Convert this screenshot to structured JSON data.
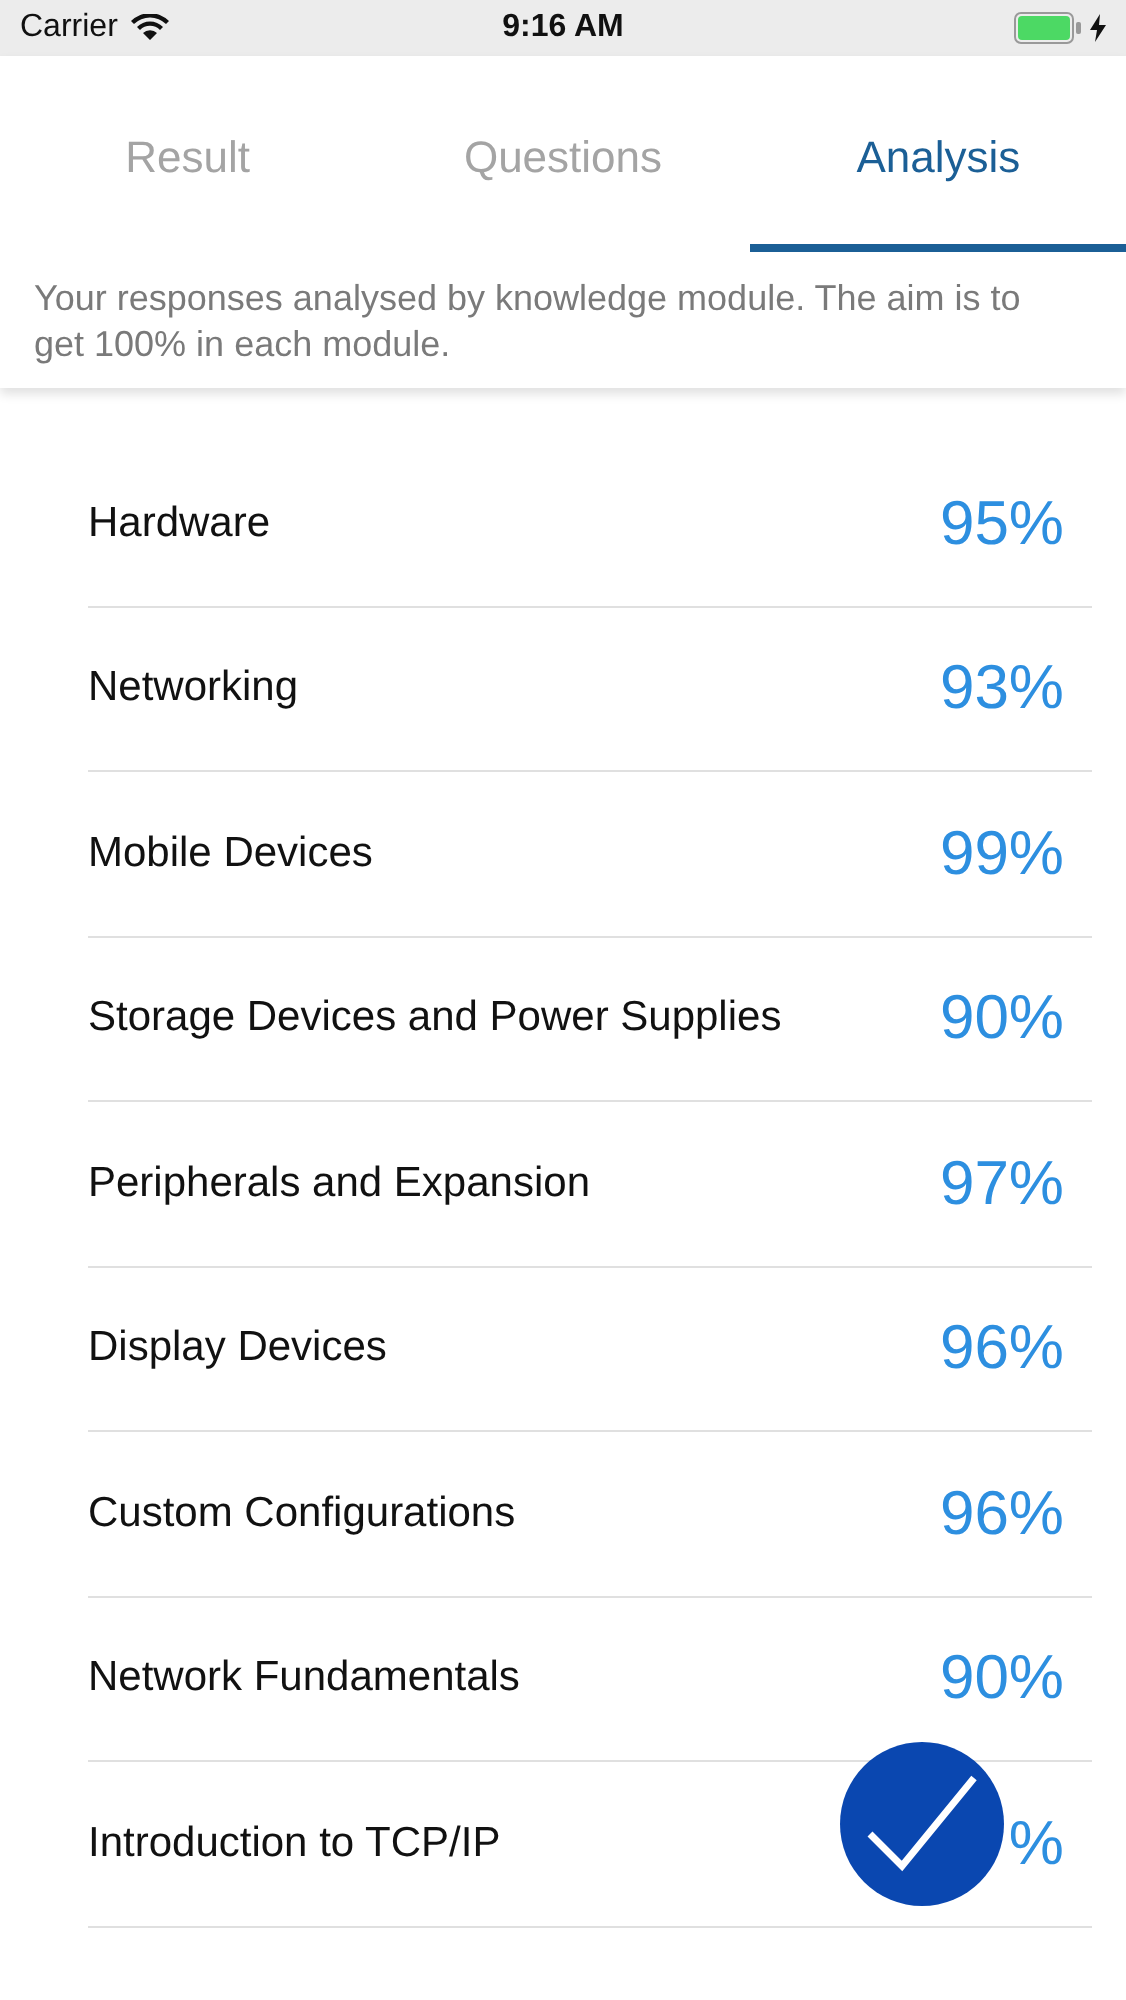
{
  "status_bar": {
    "carrier": "Carrier",
    "time": "9:16 AM"
  },
  "tabs": [
    {
      "label": "Result",
      "selected": false
    },
    {
      "label": "Questions",
      "selected": false
    },
    {
      "label": "Analysis",
      "selected": true
    }
  ],
  "description": "Your responses analysed by knowledge module. The aim is to get 100% in each module.",
  "modules": [
    {
      "name": "Hardware",
      "score": "95%"
    },
    {
      "name": "Networking",
      "score": "93%"
    },
    {
      "name": "Mobile Devices",
      "score": "99%"
    },
    {
      "name": "Storage Devices and Power Supplies",
      "score": "90%"
    },
    {
      "name": "Peripherals and Expansion",
      "score": "97%"
    },
    {
      "name": "Display Devices",
      "score": "96%"
    },
    {
      "name": "Custom Configurations",
      "score": "96%"
    },
    {
      "name": "Network Fundamentals",
      "score": "90%"
    },
    {
      "name": "Introduction to TCP/IP",
      "score": "%"
    }
  ]
}
